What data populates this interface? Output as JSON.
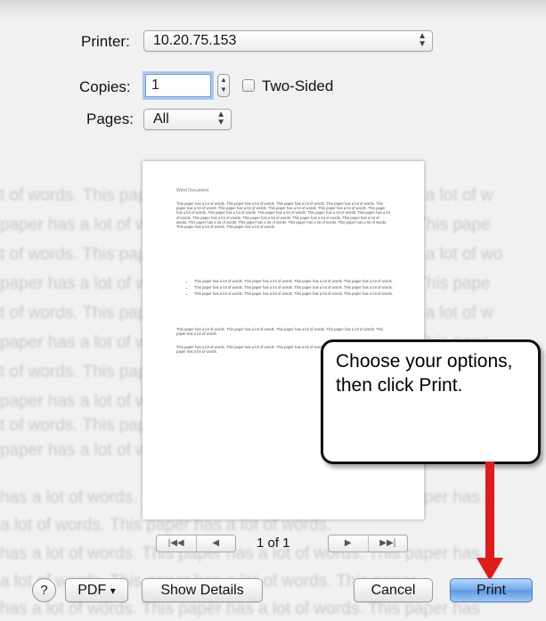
{
  "background_text": {
    "lines": [
      "t of words. This paper has a lot of words. This paper has a lot of w",
      "paper has a lot of words. This paper has a lot of words. This pape",
      "t of words. This paper has a lot of words. This paper has a lot of wo",
      "paper has a lot of words. This paper has a lot of words. This pape",
      "t of words. This paper has a lot of words. This paper has a lot of w",
      "paper has a lot of words. This paper has a lot of words. This pape",
      "t of words. This paper has a lot of words. This paper has a lot of w",
      "paper has a lot of words. This paper has a lot of words.",
      "t of words. This paper has a lot of words.",
      "paper has a lot of words.",
      "has a lot of words. This paper has a lot of words. This paper has a",
      "a lot of words. This paper has a lot of words.",
      "has a lot of words. This paper has a lot of words. This paper has a",
      "a lot of words. This paper has a lot of words. This paper",
      "has a lot of words. This paper has a lot of words. This paper has"
    ]
  },
  "printer": {
    "label": "Printer:",
    "value": "10.20.75.153"
  },
  "copies": {
    "label": "Copies:",
    "value": "1"
  },
  "two_sided": {
    "label": "Two-Sided",
    "checked": false
  },
  "pages": {
    "label": "Pages:",
    "value": "All"
  },
  "preview": {
    "doc_title": "Word Document",
    "para1": "This paper has a lot of words. This paper has a lot of words. This paper has a lot of words. This paper has a lot of words. This paper has a lot of words. This paper has a lot of words. This paper has a lot of words. This paper has a lot of words. This paper has a lot of words. This paper has a lot of words. This paper has a lot of words. This paper has a lot of words. This paper has a lot of words. This paper has a lot of words. This paper has a lot of words. This paper has a lot of words. This paper has a lot of words. This paper has a lot of words. This paper has a lot of words. This paper has a lot of words. This paper has a lot of words. This paper has a lot of words. This paper has a lot of words.",
    "bullets": [
      "This paper has a lot of words. This paper has a lot of words. This paper has a lot of words. This paper has a lot of words.",
      "This paper has a lot of words. This paper has a lot of words. This paper has a lot of words. This paper has a lot of words.",
      "This paper has a lot of words. This paper has a lot of words. This paper has a lot of words. This paper has a lot of words."
    ],
    "para2": "This paper has a lot of words. This paper has a lot of words. This paper has a lot of words. This paper has a lot of words. This paper has a lot of words.",
    "para3": "This paper has a lot of words. This paper has a lot of words. This paper has a lot of words. This paper has a lot of words. This paper has a lot of words."
  },
  "callout": {
    "text": "Choose your options, then click Print."
  },
  "pager": {
    "first": "|◀◀",
    "prev": "◀",
    "indicator": "1 of 1",
    "next": "▶",
    "last": "▶▶|"
  },
  "buttons": {
    "help": "?",
    "pdf": "PDF",
    "pdf_arrow": "▾",
    "show_details": "Show Details",
    "cancel": "Cancel",
    "print": "Print"
  },
  "colors": {
    "arrow": "#e01b1b",
    "default_button": "#6fa8ea"
  },
  "icons": {
    "help": "question-mark-icon",
    "popup": "updown-chevron-icon"
  }
}
